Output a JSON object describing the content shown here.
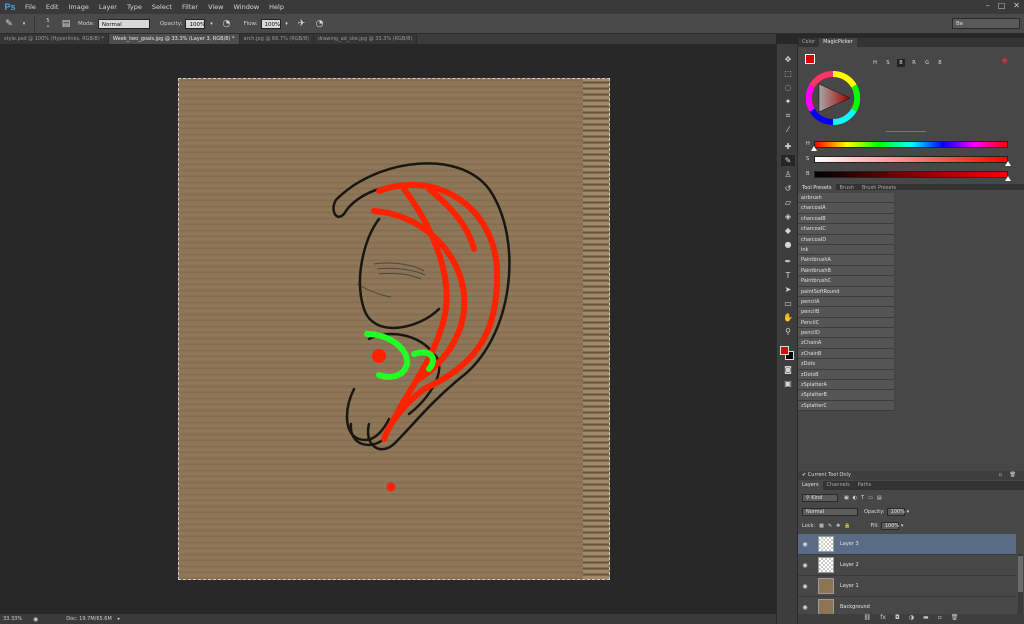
{
  "menubar": {
    "logo": "Ps",
    "items": [
      "File",
      "Edit",
      "Image",
      "Layer",
      "Type",
      "Select",
      "Filter",
      "View",
      "Window",
      "Help"
    ]
  },
  "options": {
    "brush_size": "5",
    "mode_label": "Mode:",
    "mode_value": "Normal",
    "opacity_label": "Opacity:",
    "opacity_value": "100%",
    "flow_label": "Flow:",
    "flow_value": "100%",
    "workspace": "Be"
  },
  "doc_tabs": [
    {
      "label": "style.psd @ 100% (Hyperlinks, RGB/8) *",
      "active": false
    },
    {
      "label": "Week_two_goals.jpg @ 33.3% (Layer 3, RGB/8) *",
      "active": true
    },
    {
      "label": "arch.jpg @ 66.7% (RGB/8)",
      "active": false
    },
    {
      "label": "drawing_ad_ske.jpg @ 33.3% (RGB/8)",
      "active": false
    }
  ],
  "status": {
    "zoom": "33.33%",
    "doc": "Doc: 19.7M/65.6M"
  },
  "color_panel": {
    "tabs": [
      "Color",
      "MagicPicker"
    ],
    "modes": [
      "H",
      "S",
      "B",
      "R",
      "G",
      "B"
    ],
    "sliders": [
      {
        "label": "H",
        "value": 0
      },
      {
        "label": "S",
        "value": 100
      },
      {
        "label": "B",
        "value": 100
      }
    ],
    "foreground_color": "#e00000"
  },
  "presets_panel": {
    "tabs": [
      "Tool Presets",
      "Brush",
      "Brush Presets"
    ],
    "items": [
      "airbrush",
      "charcoalA",
      "charcoalB",
      "charcoalC",
      "charcoalD",
      "ink",
      "PaintbrushA",
      "PaintbrushB",
      "PaintbrushC",
      "paintSoftRound",
      "pencilA",
      "pencilB",
      "PencilC",
      "pencilD",
      "zChainA",
      "zChainB",
      "zDots",
      "zDotsB",
      "zSplatterA",
      "zSplatterB",
      "zSplatterC"
    ],
    "current_tool_only": "Current Tool Only"
  },
  "layers_panel": {
    "tabs": [
      "Layers",
      "Channels",
      "Paths"
    ],
    "kind": "Kind",
    "blend_mode": "Normal",
    "opacity_label": "Opacity:",
    "opacity_value": "100%",
    "lock_label": "Lock:",
    "fill_label": "Fill:",
    "fill_value": "100%",
    "layers": [
      {
        "name": "Layer 3",
        "selected": true,
        "thumb": "transparent"
      },
      {
        "name": "Layer 2",
        "selected": false,
        "thumb": "transparent"
      },
      {
        "name": "Layer 1",
        "selected": false,
        "thumb": "cardboard"
      },
      {
        "name": "Background",
        "selected": false,
        "thumb": "cardboard"
      }
    ]
  }
}
